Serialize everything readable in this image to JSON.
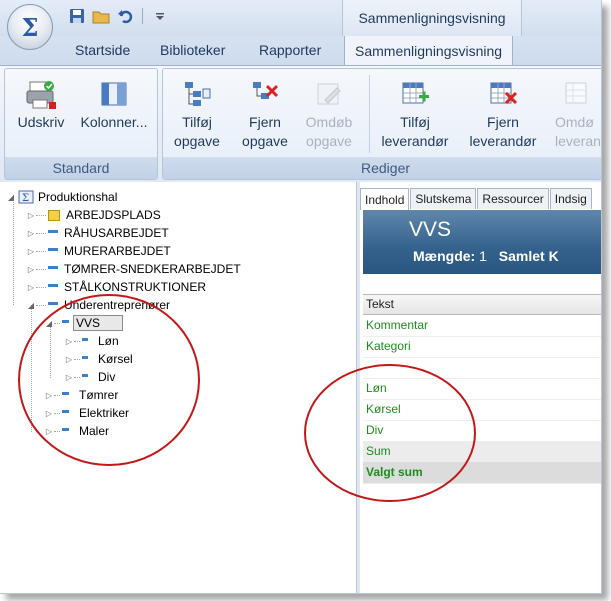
{
  "app": {
    "orb_symbol": "Σ"
  },
  "context_tab_header": "Sammenligningsvisning",
  "tabs": [
    "Startside",
    "Biblioteker",
    "Rapporter",
    "Sammenligningsvisning"
  ],
  "ribbon": {
    "standard": {
      "label": "Standard",
      "print": "Udskriv",
      "columns": "Kolonner..."
    },
    "edit": {
      "label": "Rediger",
      "add_task": [
        "Tilføj",
        "opgave"
      ],
      "remove_task": [
        "Fjern",
        "opgave"
      ],
      "rename_task": [
        "Omdøb",
        "opgave"
      ],
      "add_supplier": [
        "Tilføj",
        "leverandør"
      ],
      "remove_supplier": [
        "Fjern",
        "leverandør"
      ],
      "rename_supplier": [
        "Omdø",
        "leveran"
      ]
    }
  },
  "tree": {
    "root": "Produktionshal",
    "items": [
      "ARBEJDSPLADS",
      "RÅHUSARBEJDET",
      "MURERARBEJDET",
      "TØMRER-SNEDKERARBEJDET",
      "STÅLKONSTRUKTIONER",
      "Underentreprenører"
    ],
    "sub": {
      "selected": "VVS",
      "children": [
        "Løn",
        "Kørsel",
        "Div"
      ],
      "siblings": [
        "Tømrer",
        "Elektriker",
        "Maler"
      ]
    }
  },
  "inner_tabs": [
    "Indhold",
    "Slutskema",
    "Ressourcer",
    "Indsig"
  ],
  "banner": {
    "title": "VVS",
    "quantity_label": "Mængde:",
    "quantity_value": "1",
    "total_label": "Samlet K"
  },
  "grid": {
    "header": "Tekst",
    "rows": [
      "Kommentar",
      "Kategori",
      "",
      "Løn",
      "Kørsel",
      "Div",
      "Sum",
      "Valgt sum"
    ]
  },
  "colors": {
    "accent": "#2a5aa8",
    "green_text": "#1e8c1e",
    "annotation": "#c21818"
  }
}
